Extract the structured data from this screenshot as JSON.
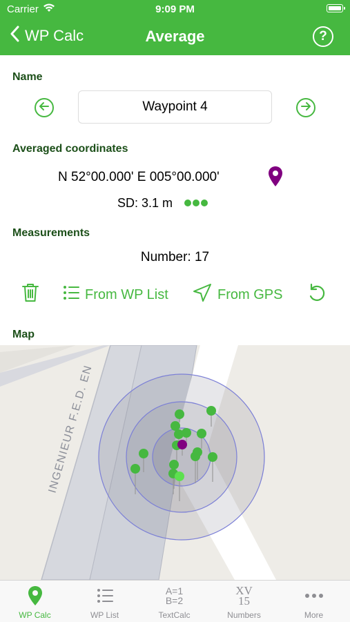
{
  "status": {
    "carrier": "Carrier",
    "time": "9:09 PM"
  },
  "nav": {
    "back_label": "WP Calc",
    "title": "Average",
    "help_icon": "question-circle-icon"
  },
  "name_section": {
    "label": "Name",
    "value": "Waypoint 4",
    "prev_icon": "arrow-left-circle-icon",
    "next_icon": "arrow-right-circle-icon"
  },
  "averaged": {
    "label": "Averaged coordinates",
    "coords": "N 52°00.000' E 005°00.000'",
    "sd": "SD: 3.1 m",
    "quality_dots": 3,
    "pin_color": "#800080"
  },
  "measurements": {
    "label": "Measurements",
    "number": "Number: 17"
  },
  "actions": {
    "delete_icon": "trash-icon",
    "from_wp_list": "From WP List",
    "from_gps": "From GPS",
    "reset_icon": "rotate-ccw-icon"
  },
  "map": {
    "label": "Map",
    "street_name": "INGENIEUR F.E.D. EN"
  },
  "tabs": [
    {
      "label": "WP Calc",
      "icon": "map-pin-icon",
      "active": true
    },
    {
      "label": "WP List",
      "icon": "list-icon",
      "active": false
    },
    {
      "label": "TextCalc",
      "icon": "formula-icon",
      "icon_text_1": "A=1",
      "icon_text_2": "B=2",
      "active": false
    },
    {
      "label": "Numbers",
      "icon": "roman-numerals-icon",
      "icon_text_1": "XV",
      "icon_text_2": "15",
      "active": false
    },
    {
      "label": "More",
      "icon": "more-dots-icon",
      "active": false
    }
  ],
  "colors": {
    "accent": "#46b840",
    "section_label": "#1c4f19",
    "pin_purple": "#800080",
    "status_green": "#46b840"
  }
}
